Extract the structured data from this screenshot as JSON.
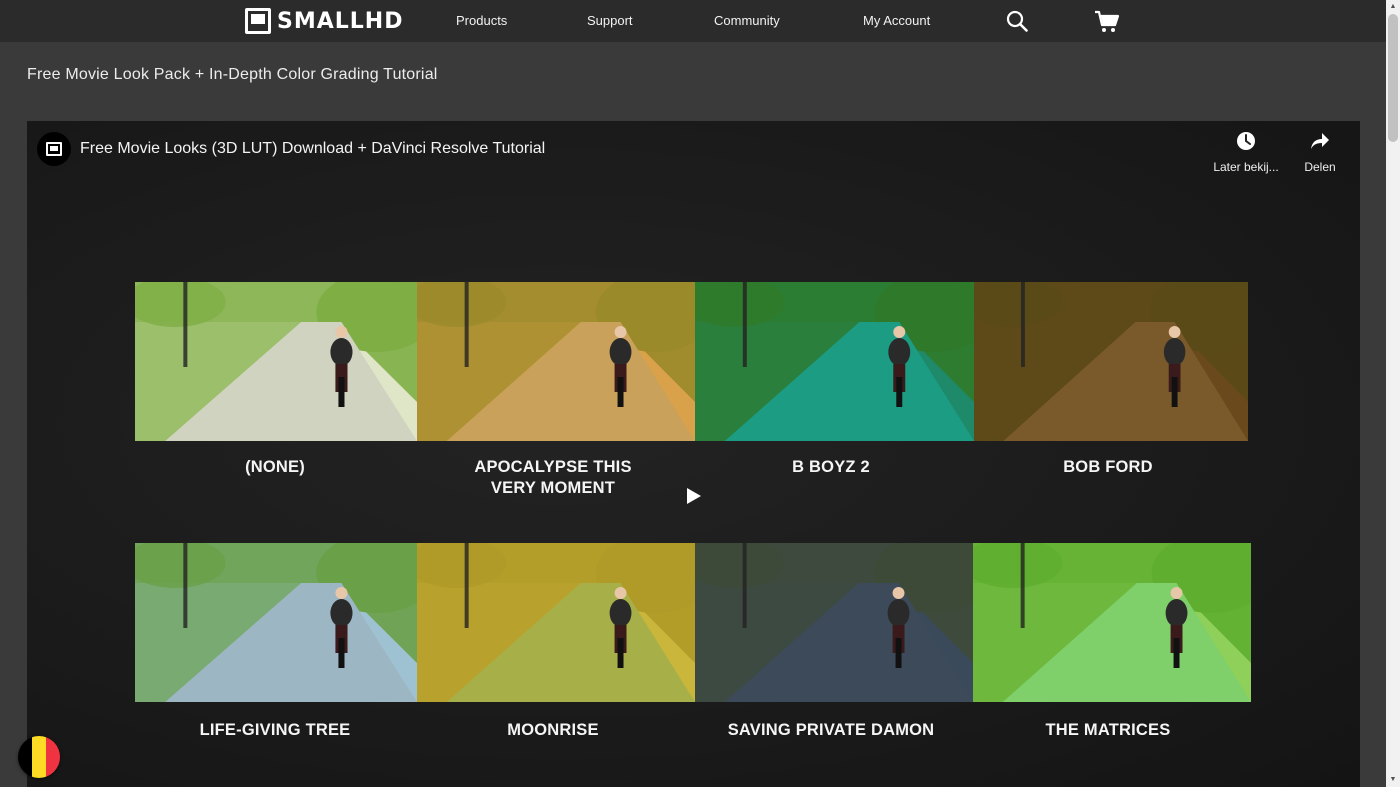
{
  "nav": {
    "logo_text": "SMALLHD",
    "items": [
      {
        "label": "Products"
      },
      {
        "label": "Support"
      },
      {
        "label": "Community"
      },
      {
        "label": "My Account"
      }
    ],
    "icons": [
      "search-icon",
      "cart-icon"
    ]
  },
  "page": {
    "title": "Free Movie Look Pack + In-Depth Color Grading Tutorial"
  },
  "video": {
    "title": "Free Movie Looks (3D LUT) Download + DaVinci Resolve Tutorial",
    "watch_later_label": "Later bekij...",
    "share_label": "Delen",
    "looks": [
      {
        "label": "(NONE)",
        "tint": "#dfe6c8",
        "road": "#cfd3c0",
        "grass": "#7fae45"
      },
      {
        "label": "APOCALYPSE THIS\nVERY MOMENT",
        "tint": "#d9a24a",
        "road": "#c9a15a",
        "grass": "#9a8a2a"
      },
      {
        "label": "B BOYZ 2",
        "tint": "#1f8a6a",
        "road": "#1d9c84",
        "grass": "#2f7a2a"
      },
      {
        "label": "BOB FORD",
        "tint": "#6a4a1c",
        "road": "#7a5a2a",
        "grass": "#5a4a18"
      },
      {
        "label": "LIFE-GIVING TREE",
        "tint": "#9fc2d2",
        "road": "#9db6c4",
        "grass": "#6aa048"
      },
      {
        "label": "MOONRISE",
        "tint": "#c9b63a",
        "road": "#a7b048",
        "grass": "#b09a28"
      },
      {
        "label": "SAVING PRIVATE DAMON",
        "tint": "#3a4a5a",
        "road": "#3c4a5a",
        "grass": "#3e4a38"
      },
      {
        "label": "THE MATRICES",
        "tint": "#8ed05a",
        "road": "#7fcf6a",
        "grass": "#5fae30"
      }
    ]
  },
  "colors": {
    "background": "#3a3a3a",
    "topbar": "#2b2b2b",
    "video_bg": "#1b1b1b"
  },
  "flag": {
    "colors": [
      "#000000",
      "#fdda24",
      "#ef3340"
    ]
  }
}
